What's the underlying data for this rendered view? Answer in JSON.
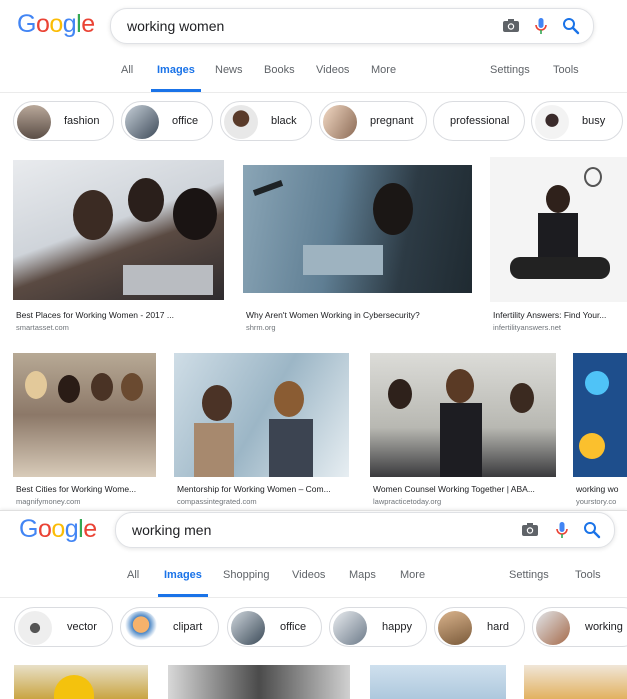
{
  "top": {
    "logo": "Google",
    "query": "working women",
    "tabs": [
      "All",
      "Images",
      "News",
      "Books",
      "Videos",
      "More"
    ],
    "right_tabs": [
      "Settings",
      "Tools"
    ],
    "chips": [
      "fashion",
      "office",
      "black",
      "pregnant",
      "professional",
      "busy"
    ],
    "results": [
      {
        "title": "Best Places for Working Women - 2017 ...",
        "source": "smartasset.com"
      },
      {
        "title": "Why Aren't Women Working in Cybersecurity?",
        "source": "shrm.org"
      },
      {
        "title": "Infertility Answers: Find Your...",
        "source": "infertilityanswers.net"
      },
      {
        "title": "Best Cities for Working Wome...",
        "source": "magnifymoney.com"
      },
      {
        "title": "Mentorship for Working Women – Com...",
        "source": "compassintegrated.com"
      },
      {
        "title": "Women Counsel Working Together | ABA...",
        "source": "lawpracticetoday.org"
      },
      {
        "title": "working wo",
        "source": "yourstory.co"
      }
    ]
  },
  "bottom": {
    "logo": "Google",
    "query": "working men",
    "tabs": [
      "All",
      "Images",
      "Shopping",
      "Videos",
      "Maps",
      "More"
    ],
    "right_tabs": [
      "Settings",
      "Tools"
    ],
    "chips": [
      "vector",
      "clipart",
      "office",
      "happy",
      "hard",
      "working"
    ]
  },
  "colors": {
    "accent": "#1a73e8",
    "mic_blue": "#4285f4",
    "mic_red": "#ea4335"
  }
}
